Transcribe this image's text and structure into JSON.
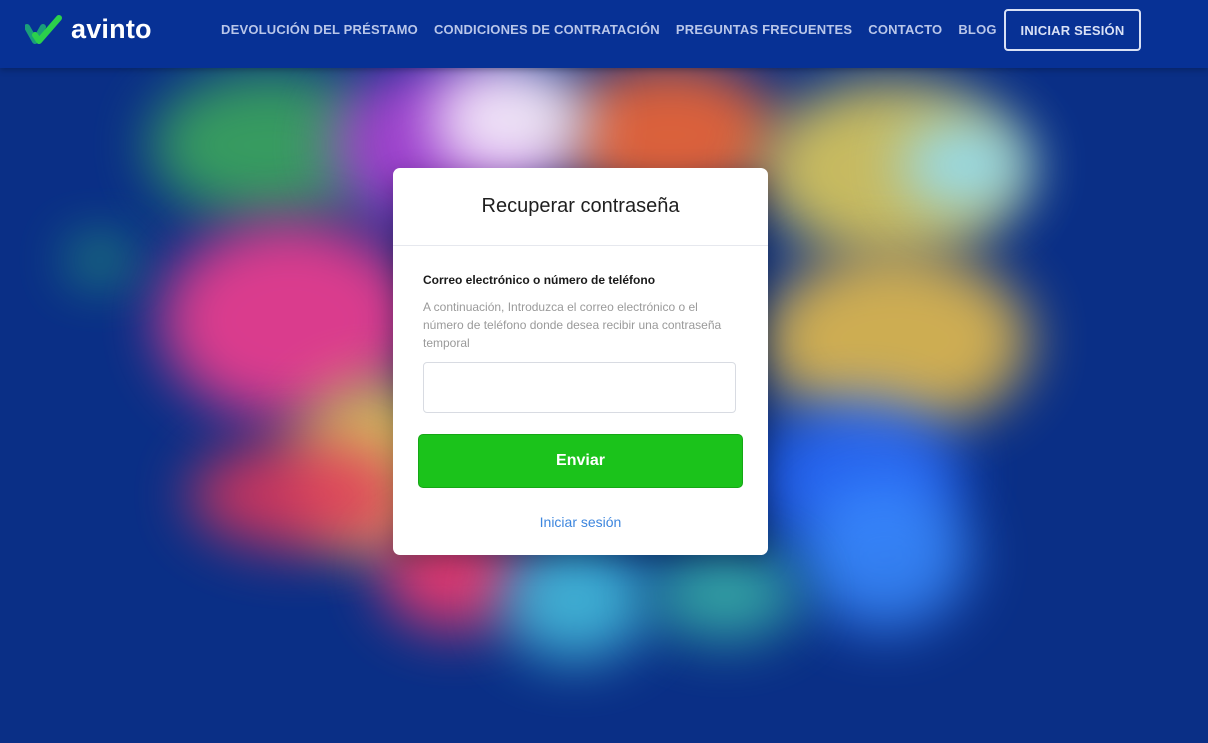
{
  "brand": {
    "name": "avinto",
    "logo_colors": {
      "primary": "#2bd14b",
      "secondary": "#1a9e7a"
    }
  },
  "nav": {
    "items": [
      {
        "label": "DEVOLUCIÓN DEL PRÉSTAMO"
      },
      {
        "label": "CONDICIONES DE CONTRATACIÓN"
      },
      {
        "label": "PREGUNTAS FRECUENTES"
      },
      {
        "label": "CONTACTO"
      },
      {
        "label": "BLOG"
      }
    ],
    "login_label": "INICIAR SESIÓN"
  },
  "recovery": {
    "title": "Recuperar contraseña",
    "field_label": "Correo electrónico o número de teléfono",
    "field_help": "A continuación, Introduzca el correo electrónico o el número de teléfono donde desea recibir una contraseña temporal",
    "field_value": "",
    "submit_label": "Enviar",
    "signin_link": "Iniciar sesión"
  },
  "colors": {
    "header_bg": "#073195",
    "page_bg": "#0a2f86",
    "submit_bg": "#1bc31b",
    "link": "#3d86de"
  }
}
